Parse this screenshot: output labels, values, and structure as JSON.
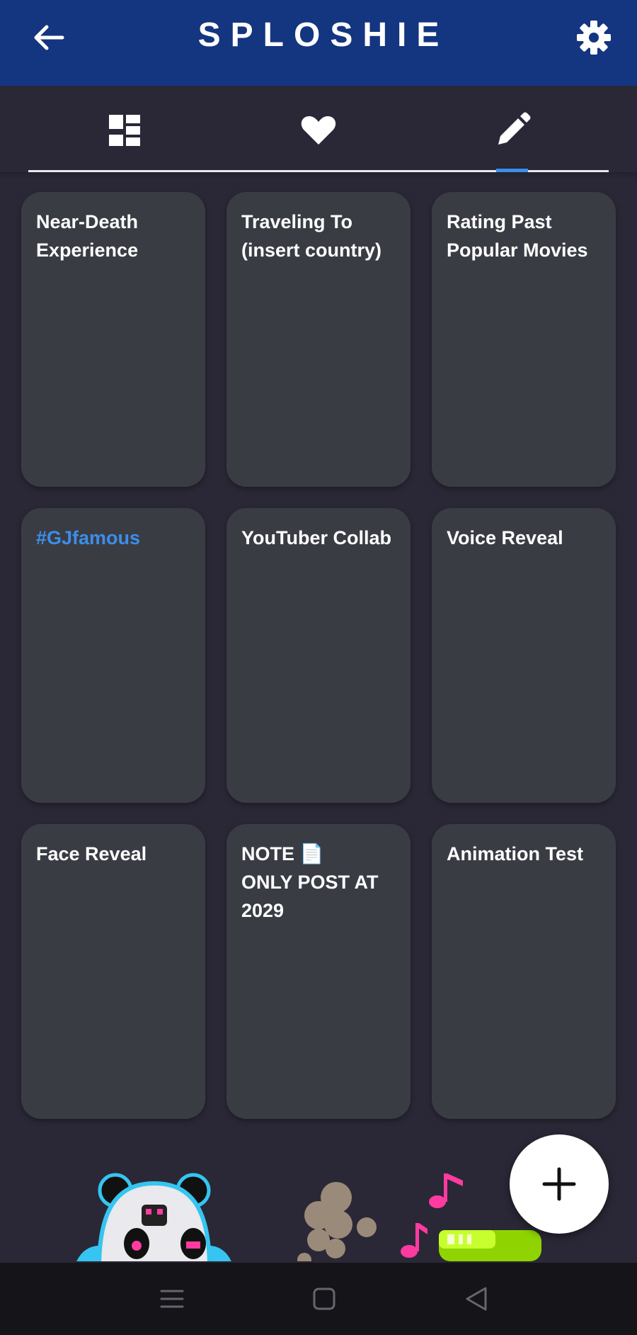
{
  "app": {
    "title": "SPLOSHIE"
  },
  "header": {
    "back_icon": "arrow-left-icon",
    "settings_icon": "gear-icon"
  },
  "tabs": [
    {
      "icon": "dashboard-icon",
      "selected": false
    },
    {
      "icon": "heart-icon",
      "selected": false
    },
    {
      "icon": "pencil-icon",
      "selected": true
    }
  ],
  "cards": [
    {
      "text": "Near-Death\nExperience",
      "link": false
    },
    {
      "text": "Traveling To\n(insert country)",
      "link": false
    },
    {
      "text": "Rating Past\nPopular Movies",
      "link": false
    },
    {
      "text": "#GJfamous",
      "link": true
    },
    {
      "text": "YouTuber Collab",
      "link": false
    },
    {
      "text": "Voice Reveal",
      "link": false
    },
    {
      "text": "Face Reveal",
      "link": false
    },
    {
      "text": "NOTE 📄\nONLY POST AT\n2029",
      "link": false
    },
    {
      "text": "Animation Test",
      "link": false
    }
  ],
  "fab": {
    "icon": "plus-icon"
  },
  "system_nav": {
    "icons": [
      "menu-icon",
      "home-square-icon",
      "back-triangle-icon"
    ]
  },
  "colors": {
    "appbar": "#143580",
    "background": "#2a2836",
    "card": "#3a3c44",
    "accent": "#3c8ee8"
  }
}
